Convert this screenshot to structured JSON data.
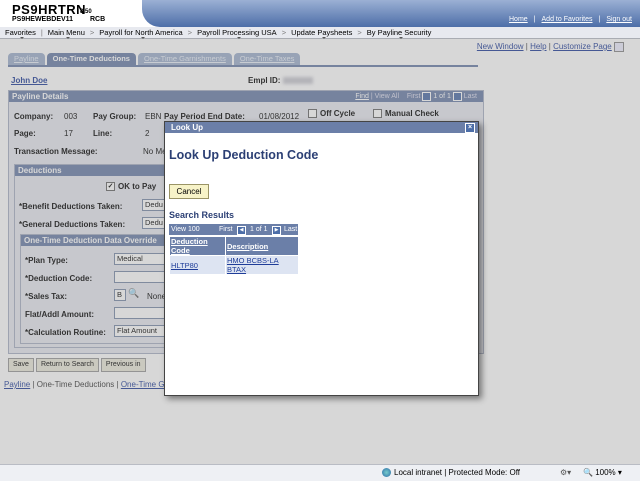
{
  "header": {
    "title": "PS9HRTRN",
    "version": "8.50",
    "database": "PS9HEWEBDEV11",
    "user": "RCB",
    "links": [
      "Home",
      "Add to Favorites",
      "Sign out"
    ]
  },
  "menu": [
    "Favorites",
    "Main Menu",
    "Payroll for North America",
    "Payroll Processing USA",
    "Update Paysheets",
    "By Payline Security"
  ],
  "page_links": {
    "new_window": "New Window",
    "help": "Help",
    "customize": "Customize Page"
  },
  "tabs": [
    "Payline",
    "One-Time Deductions",
    "One-Time Garnishments",
    "One-Time Taxes"
  ],
  "employee": {
    "name": "John Doe",
    "empl_id_label": "Empl ID:"
  },
  "payline": {
    "header": "Payline Details",
    "nav": {
      "find": "Find",
      "view_all": "View All",
      "first": "First",
      "count": "1 of 1",
      "last": "Last"
    },
    "company_label": "Company:",
    "company": "003",
    "pay_group_label": "Pay Group:",
    "pay_group": "EBN",
    "period_end_label": "Pay Period End Date:",
    "period_end": "01/08/2012",
    "off_cycle_label": "Off Cycle",
    "manual_check_label": "Manual Check",
    "page_label": "Page:",
    "page": "17",
    "line_label": "Line:",
    "line": "2",
    "transaction_label": "Transaction Message:",
    "transaction": "No Me"
  },
  "deductions": {
    "header": "Deductions",
    "ok_to_pay_label": "OK to Pay",
    "benefit_label": "*Benefit Deductions Taken:",
    "benefit_value": "Dedu",
    "general_label": "*General Deductions Taken:",
    "general_value": "Dedu"
  },
  "override": {
    "header": "One-Time Deduction Data Override",
    "plan_type_label": "*Plan Type:",
    "plan_type": "Medical",
    "deduction_code_label": "*Deduction Code:",
    "sales_tax_label": "*Sales Tax:",
    "sales_tax": "B",
    "sales_tax_desc": "None",
    "flat_amount_label": "Flat/Addl Amount:",
    "calc_routine_label": "*Calculation Routine:",
    "calc_routine": "Flat Amount"
  },
  "bottom_buttons": [
    "Save",
    "Return to Search",
    "Previous in"
  ],
  "bottom_links": [
    "Payline",
    "One-Time Deductions",
    "One-Time Garn"
  ],
  "modal": {
    "header": "Look Up",
    "close": "×",
    "title": "Look Up Deduction Code",
    "cancel": "Cancel",
    "results_title": "Search Results",
    "nav": {
      "view": "View 100",
      "first": "First",
      "count": "1 of 1",
      "last": "Last"
    },
    "columns": [
      "Deduction Code",
      "Description"
    ],
    "rows": [
      [
        "HLTP80",
        "HMO BCBS-LA BTAX"
      ]
    ]
  },
  "status_bar": {
    "zone": "Local intranet | Protected Mode: Off",
    "zoom": "100%"
  }
}
